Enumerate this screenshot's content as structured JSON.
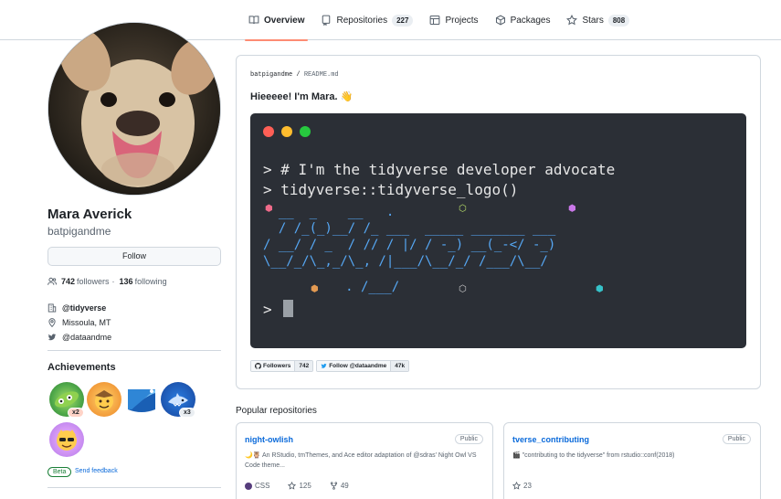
{
  "nav": {
    "tabs": [
      {
        "label": "Overview",
        "count": null,
        "icon": "book-icon",
        "active": true
      },
      {
        "label": "Repositories",
        "count": "227",
        "icon": "repo-icon",
        "active": false
      },
      {
        "label": "Projects",
        "count": null,
        "icon": "table-icon",
        "active": false
      },
      {
        "label": "Packages",
        "count": null,
        "icon": "package-icon",
        "active": false
      },
      {
        "label": "Stars",
        "count": "808",
        "icon": "star-icon",
        "active": false
      }
    ]
  },
  "profile": {
    "name": "Mara Averick",
    "login": "batpigandme",
    "follow_label": "Follow",
    "followers": "742",
    "followers_label": "followers",
    "following": "136",
    "following_label": "following",
    "separator": "·",
    "org": "@tidyverse",
    "location": "Missoula, MT",
    "twitter": "@dataandme"
  },
  "achievements": {
    "title": "Achievements",
    "badges": [
      {
        "name": "pair-extraordinaire",
        "count": "x2"
      },
      {
        "name": "starstruck",
        "count": null
      },
      {
        "name": "arctic-code-vault",
        "count": null
      },
      {
        "name": "pull-shark",
        "count": "x3"
      },
      {
        "name": "yolo",
        "count": null
      }
    ],
    "beta_label": "Beta",
    "feedback_label": "Send feedback"
  },
  "readme": {
    "owner": "batpigandme",
    "slash": " / ",
    "file": "README.md",
    "heading": "Hieeeee! I'm Mara. 👋",
    "terminal": {
      "line1": "> # I'm the tidyverse developer advocate",
      "line2": "> tidyverse::tidyverse_logo()",
      "logo": [
        "  __  _    __   .     ",
        "  / /_(_)__/ /_ ___  _____ _______ ___",
        "/ __/ / _  / // / |/ / -_) __(_-</ -_)",
        "\\__/_/\\_,_/\\_, /|___/\\__/_/ /___/\\__/",
        "     . /___/"
      ],
      "prompt": ">",
      "hexes": [
        "⬢",
        "⬡",
        "⬢",
        "⬢",
        "⬡",
        "⬢"
      ],
      "dot_colors": [
        "#ff5f56",
        "#ffbd2e",
        "#27c93f"
      ]
    },
    "shields": [
      {
        "left": "Followers",
        "right": "742"
      },
      {
        "left": "Follow @dataandme",
        "right": "47k"
      }
    ]
  },
  "popular": {
    "title": "Popular repositories",
    "repos": [
      {
        "name": "night-owlish",
        "visibility": "Public",
        "description": "🌙🦉 An RStudio, tmThemes, and Ace editor adaptation of @sdras' Night Owl VS Code theme...",
        "language": "CSS",
        "stars": "125",
        "forks": "49"
      },
      {
        "name": "tverse_contributing",
        "visibility": "Public",
        "description": "🎬 \"contributing to the tidyverse\" from rstudio::conf(2018)",
        "language": null,
        "stars": "23",
        "forks": null
      }
    ]
  },
  "colors": {
    "accent_tab": "#fd8c73",
    "link": "#0969da",
    "css_lang": "#563d7c"
  }
}
